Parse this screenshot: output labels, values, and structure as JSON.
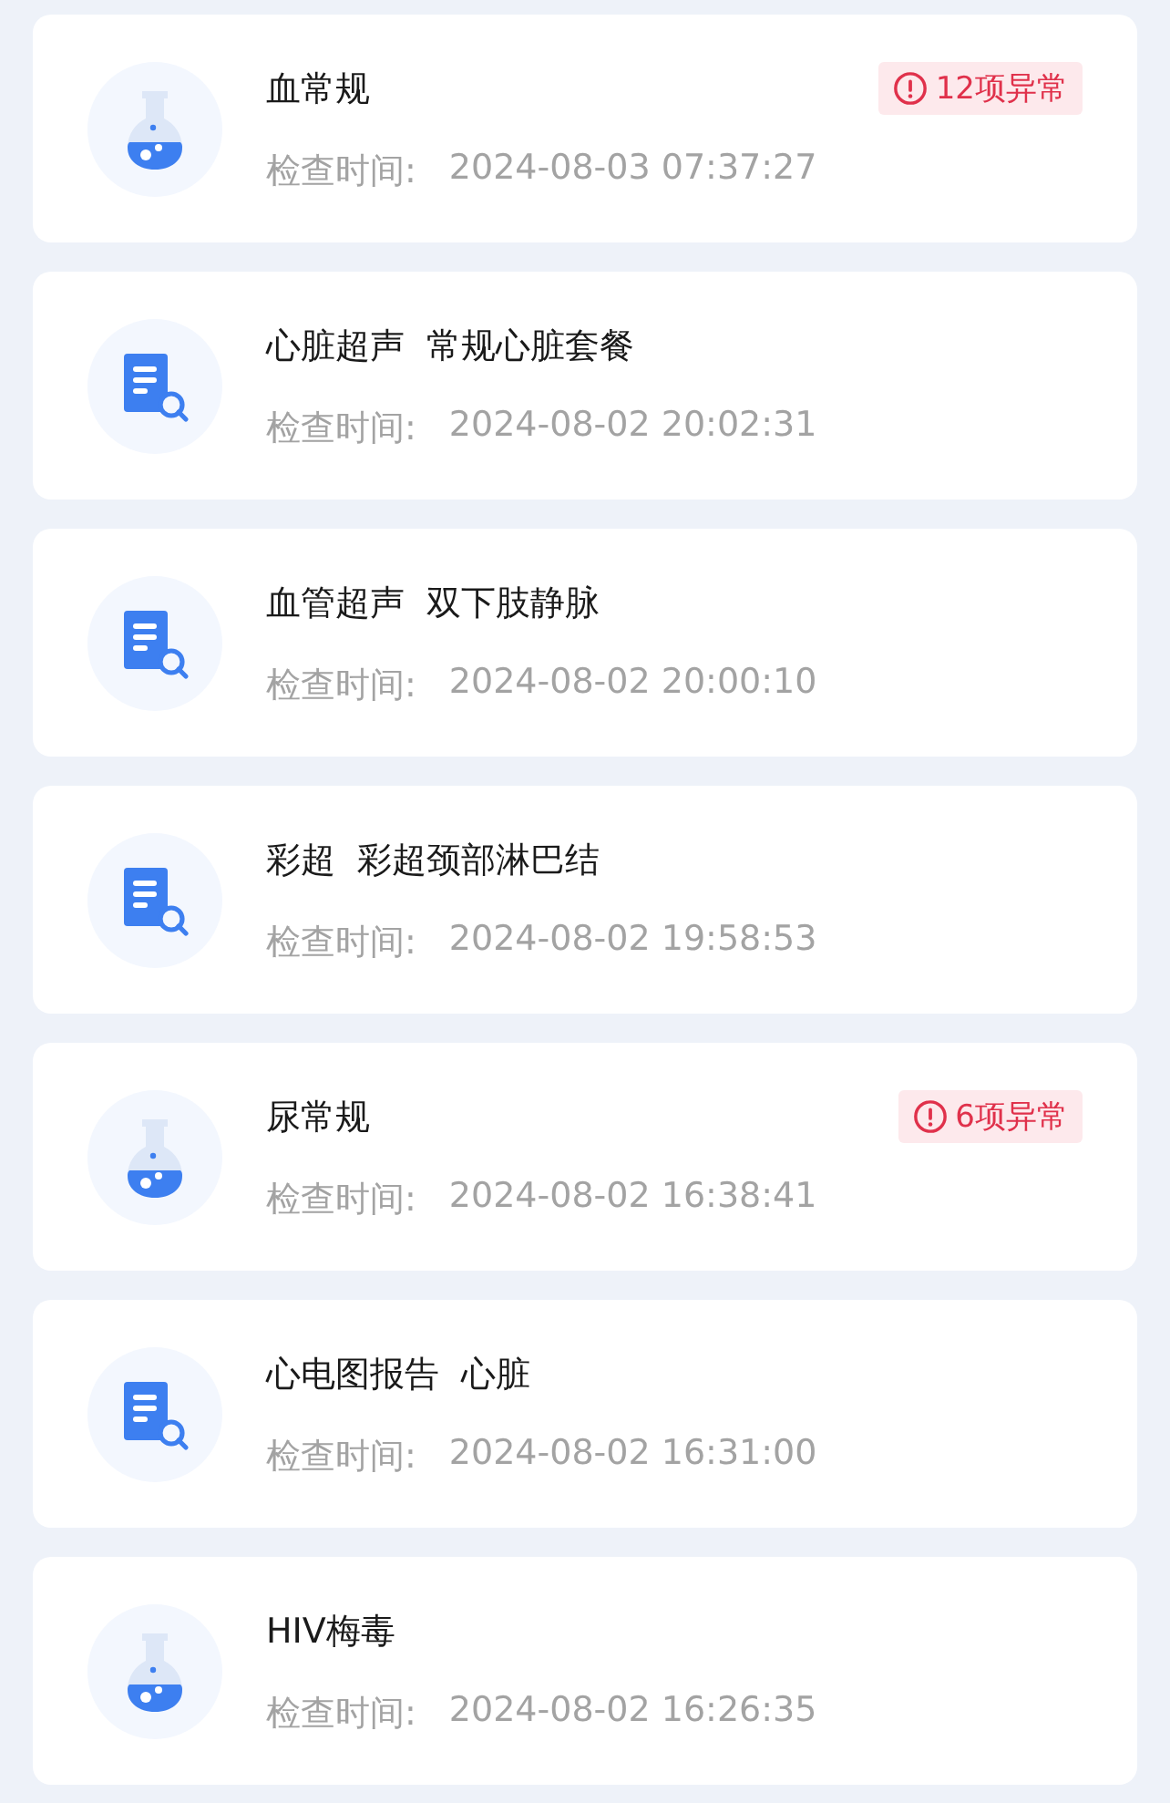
{
  "reports": [
    {
      "kind": "lab",
      "title": "血常规",
      "time_label": "检查时间:",
      "time": "2024-08-03 07:37:27",
      "abnormal": "12项异常"
    },
    {
      "kind": "report",
      "title": "心脏超声  常规心脏套餐",
      "time_label": "检查时间:",
      "time": "2024-08-02 20:02:31"
    },
    {
      "kind": "report",
      "title": "血管超声  双下肢静脉",
      "time_label": "检查时间:",
      "time": "2024-08-02 20:00:10"
    },
    {
      "kind": "report",
      "title": "彩超  彩超颈部淋巴结",
      "time_label": "检查时间:",
      "time": "2024-08-02 19:58:53"
    },
    {
      "kind": "lab",
      "title": "尿常规",
      "time_label": "检查时间:",
      "time": "2024-08-02 16:38:41",
      "abnormal": "6项异常"
    },
    {
      "kind": "report",
      "title": "心电图报告  心脏",
      "time_label": "检查时间:",
      "time": "2024-08-02 16:31:00"
    },
    {
      "kind": "lab",
      "title": "HIV梅毒",
      "time_label": "检查时间:",
      "time": "2024-08-02 16:26:35"
    }
  ]
}
